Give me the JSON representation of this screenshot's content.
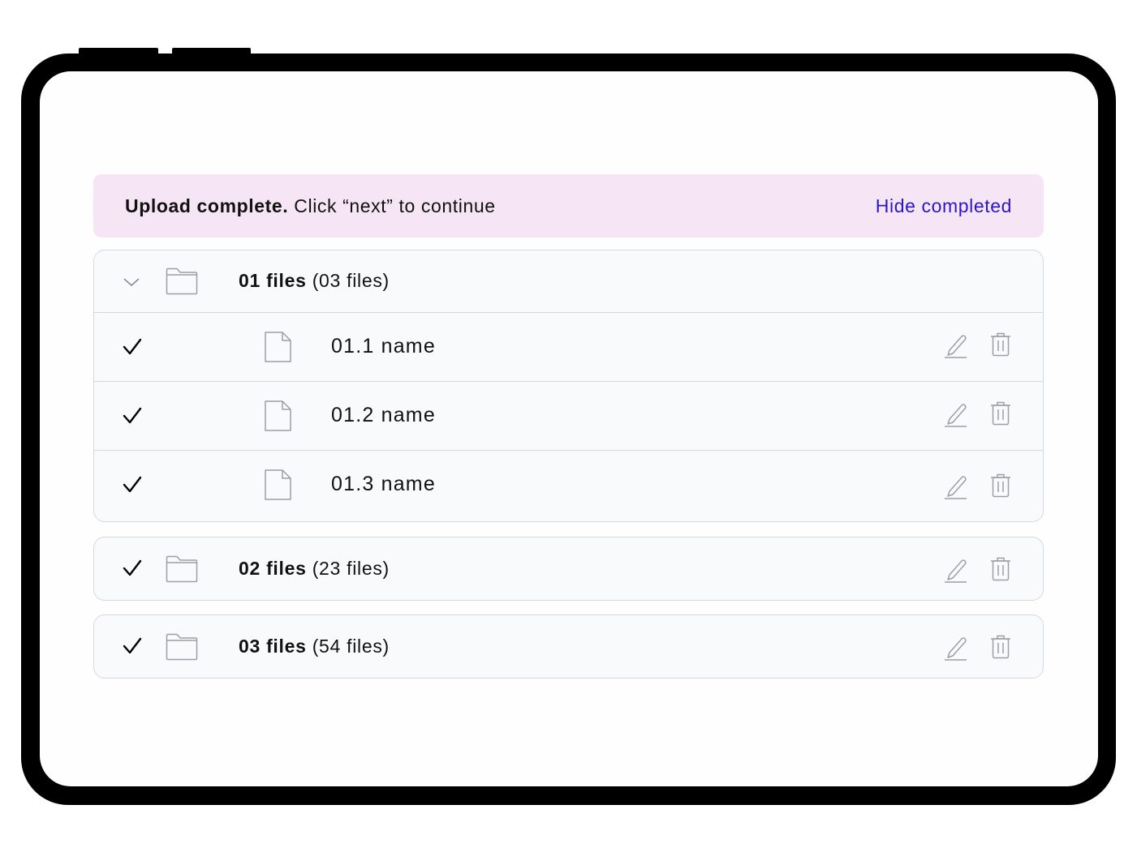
{
  "banner": {
    "bold_text": "Upload complete.",
    "text": " Click “next” to continue",
    "action_label": "Hide completed",
    "background": "#f6e6f5",
    "link_color": "#2a17c9"
  },
  "groups": [
    {
      "name": "01 files",
      "count_label": "(03 files)",
      "expanded": true,
      "files": [
        {
          "name": "01.1 name",
          "status": "complete"
        },
        {
          "name": "01.2 name",
          "status": "complete"
        },
        {
          "name": "01.3 name",
          "status": "complete"
        }
      ]
    },
    {
      "name": "02 files",
      "count_label": "(23 files)",
      "expanded": false,
      "status": "complete"
    },
    {
      "name": "03 files",
      "count_label": "(54 files)",
      "expanded": false,
      "status": "complete"
    }
  ],
  "icons": {
    "check": "check-icon",
    "chevron": "chevron-down-icon",
    "folder": "folder-icon",
    "file": "file-icon",
    "edit": "pencil-icon",
    "delete": "trash-icon"
  }
}
